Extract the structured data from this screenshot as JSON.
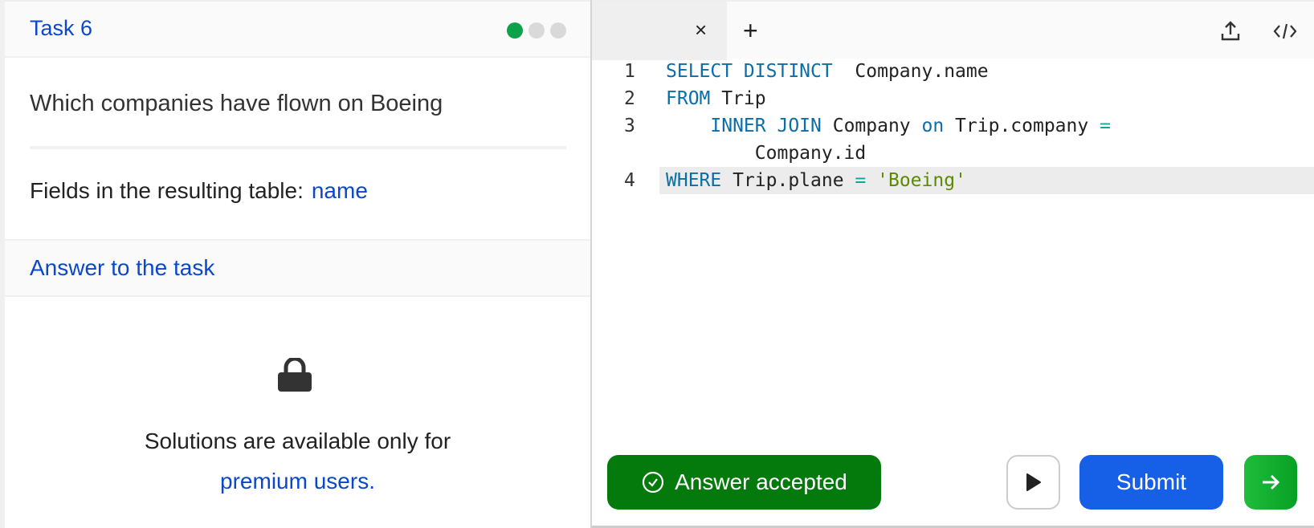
{
  "task": {
    "title": "Task 6",
    "progress_dots": [
      "done",
      "pending",
      "pending"
    ],
    "question": "Which companies have flown on Boeing",
    "fields_label": "Fields in the resulting table:",
    "fields_value": "name",
    "answer_heading": "Answer to the task",
    "locked_line1": "Solutions are available only for",
    "locked_link": "premium users."
  },
  "editor": {
    "tab_close": "×",
    "tab_add": "+",
    "lines": [
      {
        "no": "1",
        "parts": [
          [
            "kw",
            "SELECT DISTINCT"
          ],
          [
            "",
            "  Company.name"
          ]
        ]
      },
      {
        "no": "2",
        "parts": [
          [
            "kw",
            "FROM"
          ],
          [
            "",
            " Trip"
          ]
        ]
      },
      {
        "no": "3",
        "parts": [
          [
            "",
            "    "
          ],
          [
            "kw",
            "INNER JOIN"
          ],
          [
            "",
            " Company "
          ],
          [
            "kw",
            "on"
          ],
          [
            "",
            " Trip.company "
          ],
          [
            "op",
            "="
          ]
        ]
      },
      {
        "no": "",
        "parts": [
          [
            "",
            "        Company.id"
          ]
        ]
      },
      {
        "no": "4",
        "parts": [
          [
            "kw",
            "WHERE"
          ],
          [
            "",
            " Trip.plane "
          ],
          [
            "op",
            "="
          ],
          [
            "",
            " "
          ],
          [
            "str",
            "'Boeing'"
          ]
        ]
      }
    ]
  },
  "actions": {
    "status": "Answer accepted",
    "submit": "Submit"
  },
  "colors": {
    "accent": "#0b48c9",
    "success": "#047a0c",
    "submit": "#1560e6"
  }
}
